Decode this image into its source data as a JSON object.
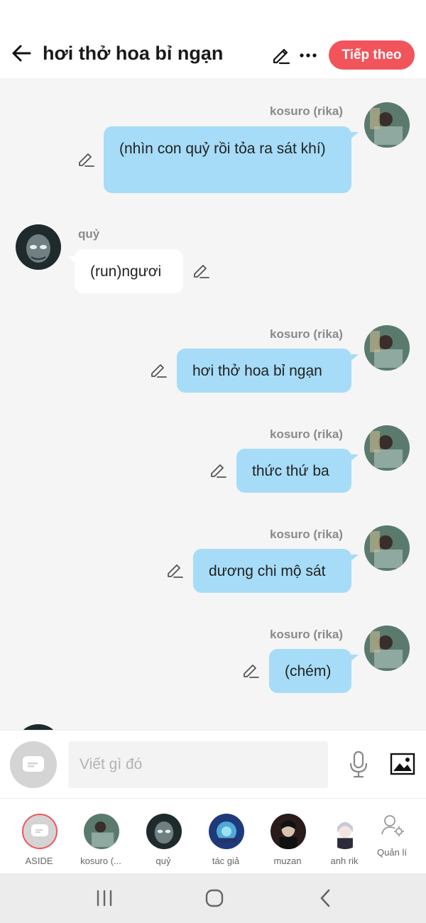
{
  "header": {
    "title": "hơi thở hoa bỉ ngạn",
    "next_label": "Tiếp theo",
    "accent_color": "#f2545b"
  },
  "messages": [
    {
      "sender": "kosuro (rika)",
      "text": "(nhìn con quỷ rồi tỏa ra sát khí)",
      "side": "right"
    },
    {
      "sender": "quỷ",
      "text": "(run)ngươi",
      "side": "left"
    },
    {
      "sender": "kosuro (rika)",
      "text": "hơi thở hoa bỉ ngạn",
      "side": "right"
    },
    {
      "sender": "kosuro (rika)",
      "text": "thức thứ ba",
      "side": "right"
    },
    {
      "sender": "kosuro (rika)",
      "text": "dương chi mộ sát",
      "side": "right"
    },
    {
      "sender": "kosuro (rika)",
      "text": "(chém)",
      "side": "right"
    }
  ],
  "input": {
    "placeholder": "Viết gì đó",
    "value": ""
  },
  "characters": [
    {
      "label": "ASIDE",
      "icon": "aside-icon"
    },
    {
      "label": "kosuro (...",
      "icon": "avatar"
    },
    {
      "label": "quỷ",
      "icon": "avatar"
    },
    {
      "label": "tác giả",
      "icon": "avatar"
    },
    {
      "label": "muzan",
      "icon": "avatar"
    },
    {
      "label": "anh rik",
      "icon": "avatar"
    },
    {
      "label": "Quản lí",
      "icon": "manage-user-icon"
    }
  ],
  "colors": {
    "my_bubble": "#a6dcf7",
    "their_bubble": "#ffffff",
    "chat_background": "#f5f5f5"
  }
}
